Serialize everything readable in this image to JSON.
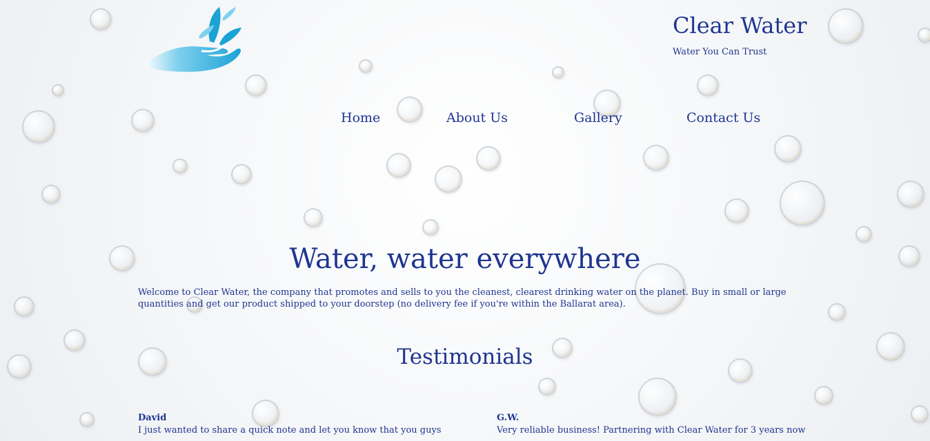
{
  "header": {
    "brand_title": "Clear Water",
    "tagline": "Water You Can Trust",
    "logo_icon": "water-hand-logo-icon"
  },
  "nav": {
    "items": [
      {
        "label": "Home"
      },
      {
        "label": "About Us"
      },
      {
        "label": "Gallery"
      },
      {
        "label": "Contact Us"
      }
    ]
  },
  "main": {
    "hero_title": "Water, water everywhere",
    "intro": "Welcome to Clear Water, the company that promotes and sells to you the cleanest, clearest drinking water on the planet. Buy in small or large quantities and get our product shipped to your doorstep (no delivery fee if you're within the Ballarat area).",
    "testimonials_title": "Testimonials",
    "testimonials": [
      {
        "author": "David",
        "text": "I just wanted to share a quick note and let you know that you guys"
      },
      {
        "author": "G.W.",
        "text": "Very reliable business! Partnering with Clear Water for 3 years now"
      }
    ]
  },
  "colors": {
    "text": "#1f3590",
    "logo_blue": "#1ba3d6",
    "logo_light": "#7fd0ee",
    "background": "#f4f6f8"
  }
}
